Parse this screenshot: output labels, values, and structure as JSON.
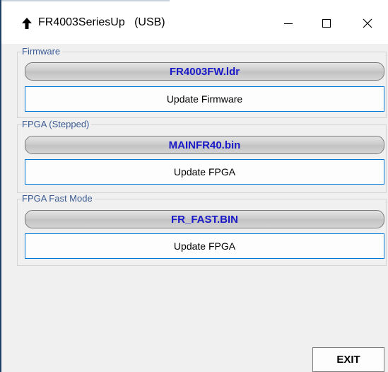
{
  "window": {
    "title": "FR4003SeriesUp   (USB)",
    "icon": "up-arrow-icon",
    "controls": [
      "minimize-icon",
      "maximize-icon",
      "close-icon"
    ]
  },
  "firmware": {
    "label": "Firmware",
    "file": "FR4003FW.ldr",
    "button": "Update Firmware"
  },
  "fpga_stepped": {
    "label": "FPGA (Stepped)",
    "file": "MAINFR40.bin",
    "button": "Update FPGA"
  },
  "fpga_fast": {
    "label": "FPGA Fast Mode",
    "file": "FR_FAST.BIN",
    "button": "Update FPGA"
  },
  "exit": {
    "label": "EXIT"
  },
  "colors": {
    "file_text": "#1919c8",
    "group_label": "#3b5b92",
    "button_border": "#0078d7"
  }
}
